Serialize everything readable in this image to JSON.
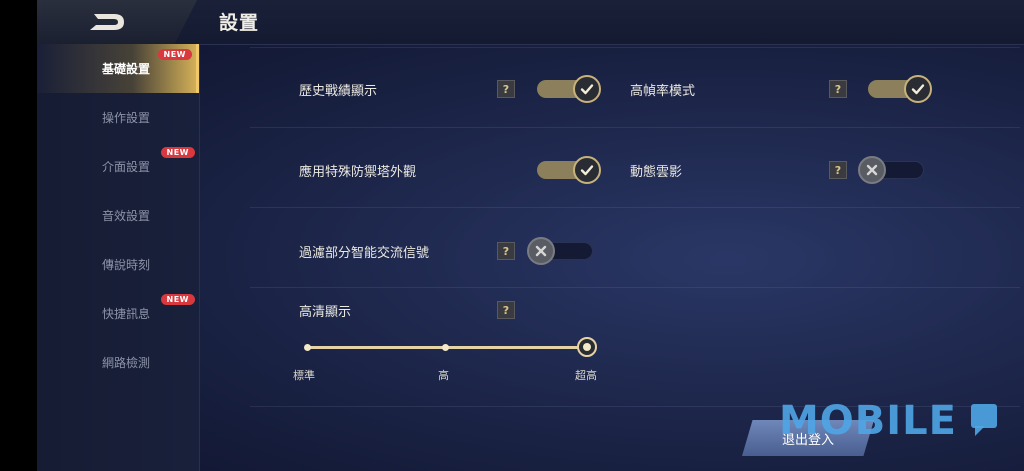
{
  "header": {
    "title": "設置"
  },
  "sidebar": {
    "items": [
      {
        "label": "基礎設置",
        "new": "NEW"
      },
      {
        "label": "操作設置"
      },
      {
        "label": "介面設置",
        "new": "NEW"
      },
      {
        "label": "音效設置"
      },
      {
        "label": "傳說時刻"
      },
      {
        "label": "快捷訊息",
        "new": "NEW"
      },
      {
        "label": "網路檢測"
      }
    ]
  },
  "settings": {
    "history_record": {
      "label": "歷史戰績顯示",
      "help": "?",
      "state": "on"
    },
    "high_fps": {
      "label": "高幀率模式",
      "help": "?",
      "state": "on"
    },
    "special_tower": {
      "label": "應用特殊防禦塔外觀",
      "state": "on"
    },
    "dynamic_clouds": {
      "label": "動態雲影",
      "help": "?",
      "state": "off"
    },
    "filter_signals": {
      "label": "過濾部分智能交流信號",
      "help": "?",
      "state": "off"
    },
    "hd_display": {
      "label": "高清顯示",
      "help": "?",
      "options": [
        "標準",
        "高",
        "超高"
      ],
      "selected": "超高"
    }
  },
  "footer": {
    "logout_label": "退出登入"
  },
  "watermark": {
    "text": "MOBILE"
  },
  "colors": {
    "accent_gold": "#c7b27c",
    "badge_red": "#d9383e",
    "logout_blue": "#5b72a6"
  }
}
